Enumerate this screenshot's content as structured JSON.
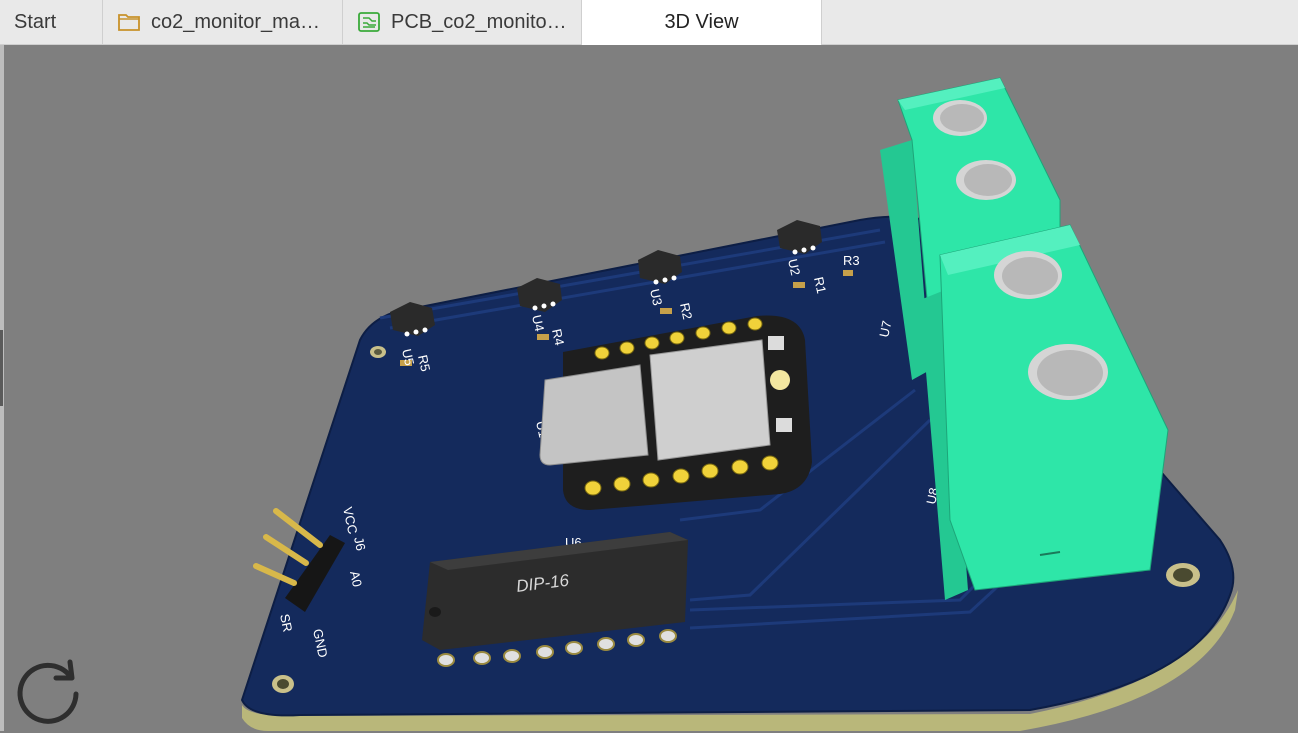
{
  "tabs": [
    {
      "label": "Start",
      "icon": "none"
    },
    {
      "label": "co2_monitor_ma…",
      "icon": "project-folder-icon"
    },
    {
      "label": "PCB_co2_monito…",
      "icon": "pcb-icon"
    },
    {
      "label": "3D View",
      "icon": "none",
      "active": true
    }
  ],
  "board": {
    "color": "#142a5c",
    "silkscreen_color": "#ffffff",
    "terminal_color": "#2ee6a8",
    "refs": {
      "u1": "U1",
      "u2": "U2",
      "u3": "U3",
      "u4": "U4",
      "u5": "U5",
      "u6": "U6",
      "u7": "U7",
      "u8": "U8",
      "j6": "J6",
      "r1": "R1",
      "r2": "R2",
      "r3": "R3",
      "r4": "R4",
      "r5": "R5"
    },
    "header_pins": [
      "VCC",
      "A0",
      "SR",
      "GND"
    ],
    "ic_label": "DIP-16"
  },
  "toolbar": {
    "refresh_icon": "refresh-icon"
  }
}
